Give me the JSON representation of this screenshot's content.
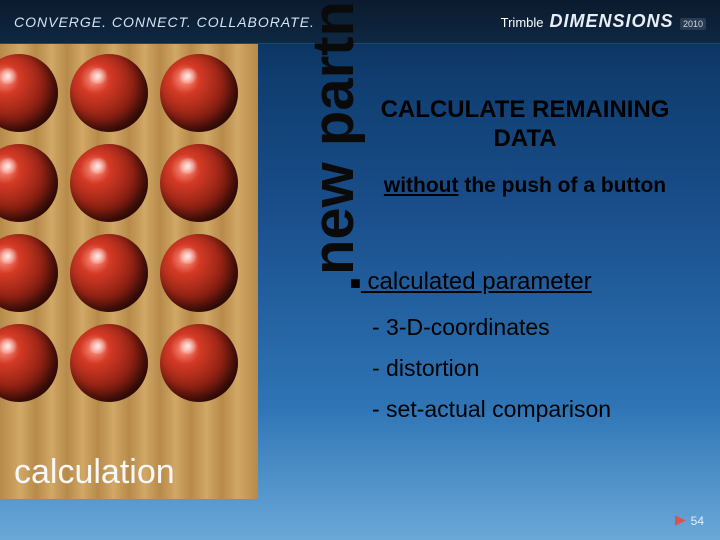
{
  "header": {
    "tagline": "CONVERGE. CONNECT. COLLABORATE.",
    "brand": "Trimble",
    "product": "DIMENSIONS",
    "year": "2010"
  },
  "left": {
    "caption": "calculation",
    "vertical_label": "new partnership"
  },
  "content": {
    "headline_line1": "CALCULATE REMAINING",
    "headline_line2": "DATA",
    "subhead_underlined": "without",
    "subhead_rest": " the push of a button",
    "bullet_main_underlined": " calculated parameter",
    "subitems": [
      "- 3-D-coordinates",
      "- distortion",
      "- set-actual comparison"
    ]
  },
  "footer": {
    "page_number": "54"
  }
}
